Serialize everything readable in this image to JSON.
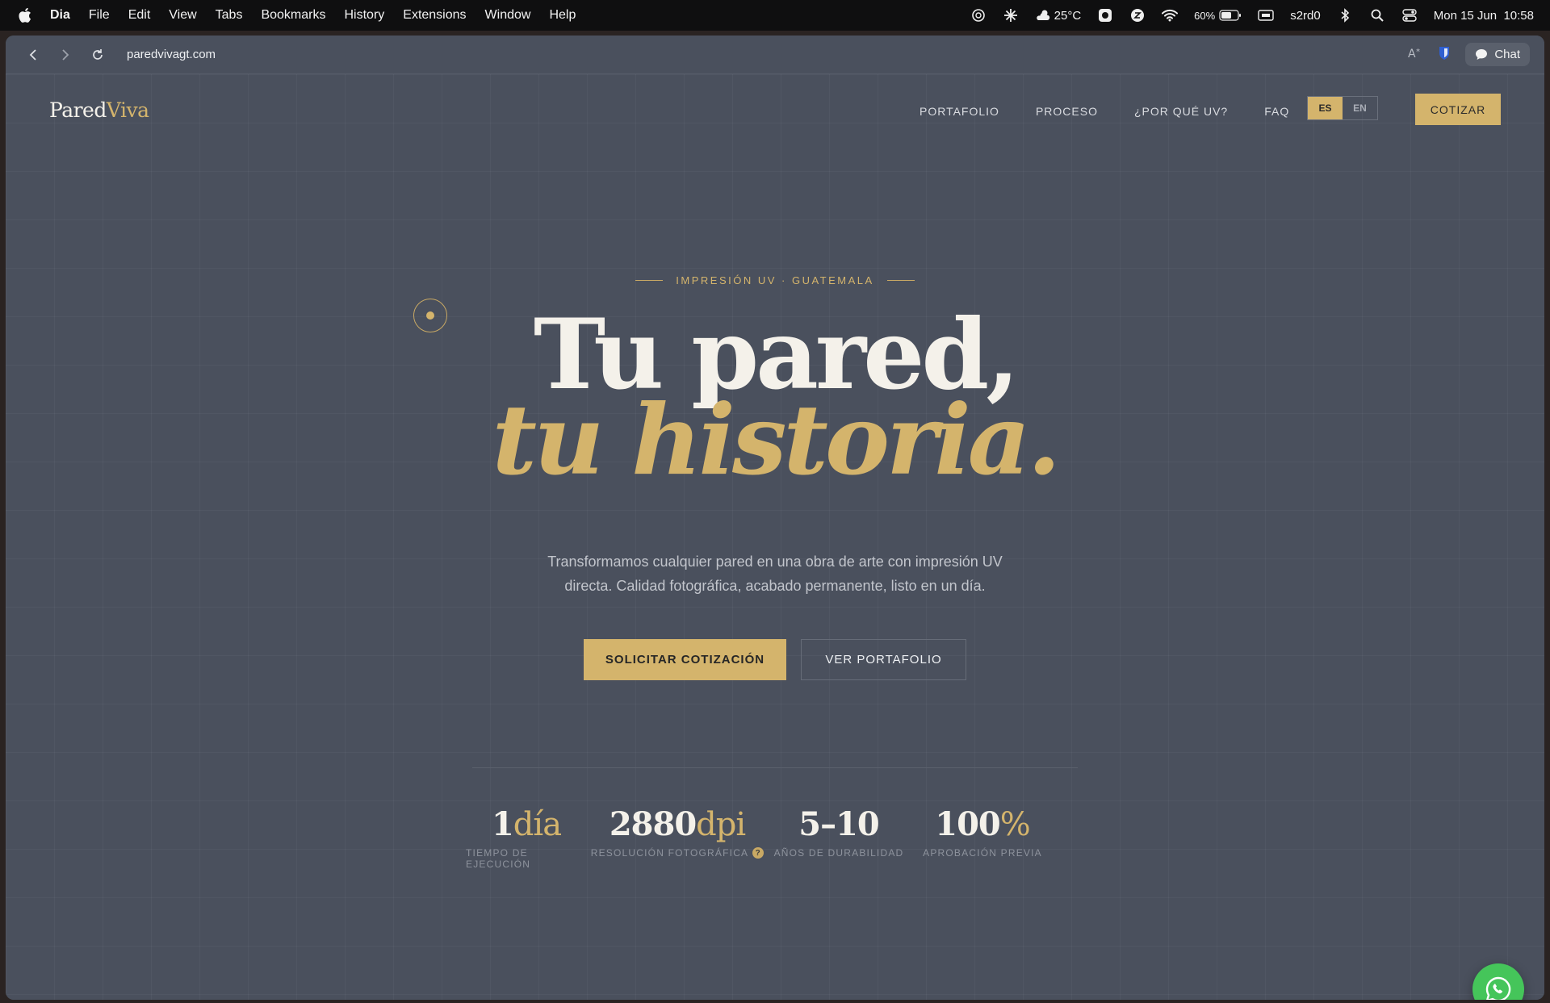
{
  "menubar": {
    "app_name": "Dia",
    "items": [
      "File",
      "Edit",
      "View",
      "Tabs",
      "Bookmarks",
      "History",
      "Extensions",
      "Window",
      "Help"
    ],
    "weather": "25°C",
    "battery": "60%",
    "user": "s2rd0",
    "datetime": "Mon 15 Jun  10:58"
  },
  "browser": {
    "url": "paredvivagt.com",
    "chat_label": "Chat"
  },
  "site": {
    "logo_part1": "Pared",
    "logo_part2": "Viva",
    "nav": [
      "PORTAFOLIO",
      "PROCESO",
      "¿POR QUÉ UV?",
      "FAQ"
    ],
    "lang_es": "ES",
    "lang_en": "EN",
    "quote_button": "COTIZAR"
  },
  "hero": {
    "eyebrow": "IMPRESIÓN UV · GUATEMALA",
    "title_line1": "Tu pared,",
    "title_line2": "tu historia.",
    "subtitle": "Transformamos cualquier pared en una obra de arte con impresión UV directa. Calidad fotográfica, acabado permanente, listo en un día.",
    "cta_primary": "SOLICITAR COTIZACIÓN",
    "cta_secondary": "VER PORTAFOLIO"
  },
  "stats": [
    {
      "number": "1",
      "unit": "día",
      "label": "TIEMPO DE EJECUCIÓN"
    },
    {
      "number": "2880",
      "unit": "dpi",
      "label": "RESOLUCIÓN FOTOGRÁFICA"
    },
    {
      "number": "5–10",
      "unit": "",
      "label": "AÑOS DE DURABILIDAD"
    },
    {
      "number": "100",
      "unit": "%",
      "label": "APROBACIÓN PREVIA"
    }
  ],
  "colors": {
    "accent": "#d4b46c",
    "page_bg": "#4a505d",
    "whatsapp": "#45c55a"
  }
}
